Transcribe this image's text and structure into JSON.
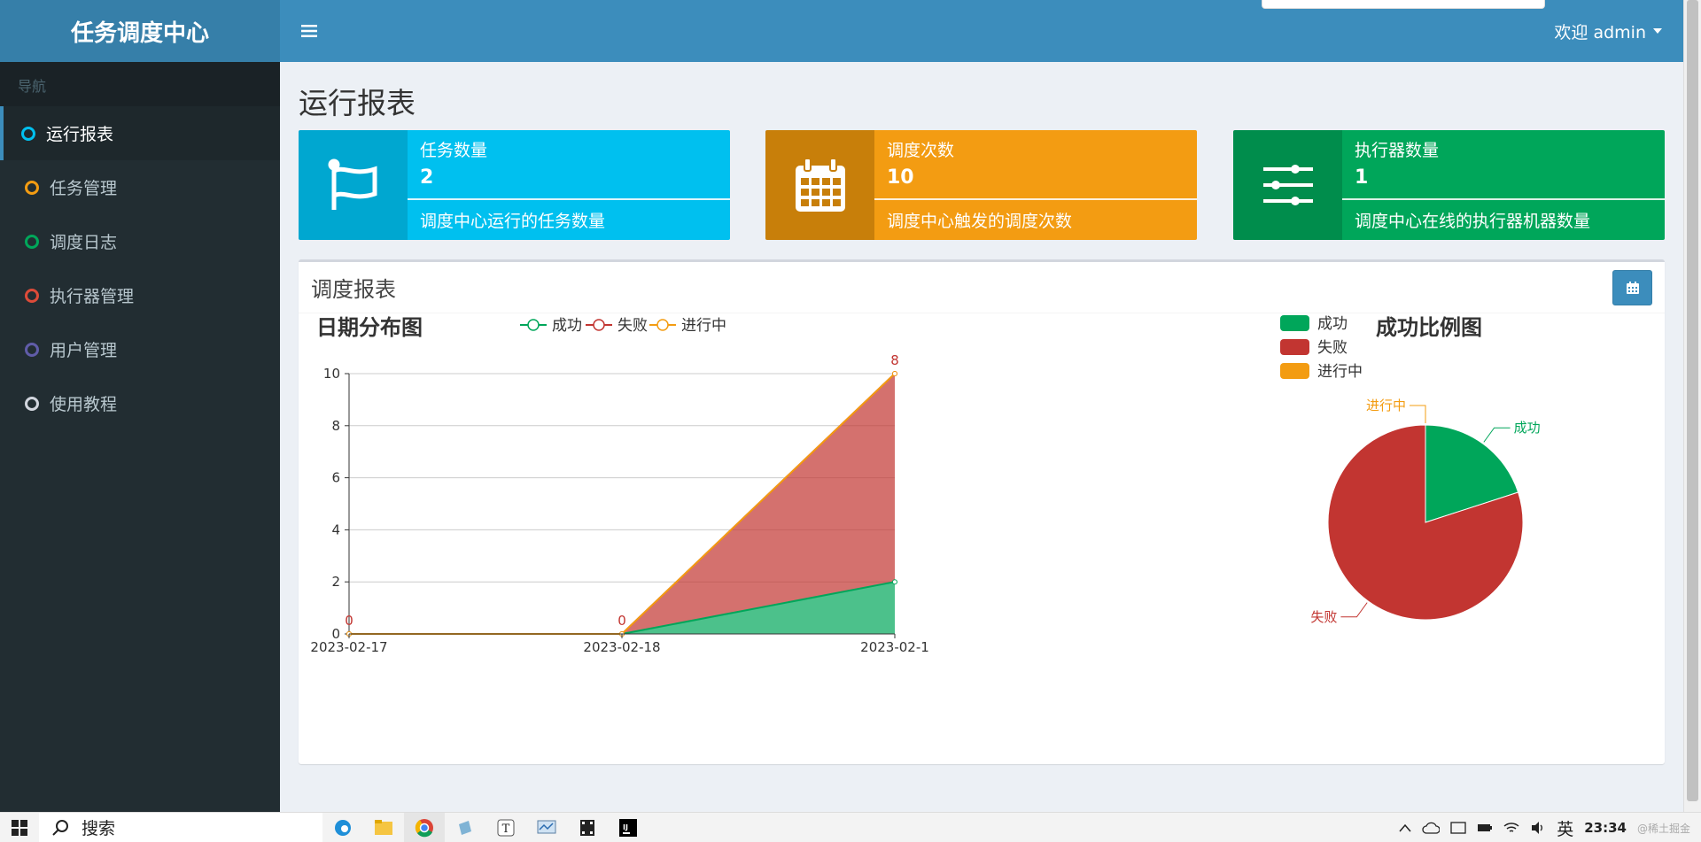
{
  "app": {
    "title": "任务调度中心"
  },
  "header": {
    "welcome": "欢迎 admin"
  },
  "nav": {
    "header": "导航",
    "items": [
      {
        "label": "运行报表",
        "color": "#00c0ef",
        "active": true
      },
      {
        "label": "任务管理",
        "color": "#f39c12"
      },
      {
        "label": "调度日志",
        "color": "#00a65a"
      },
      {
        "label": "执行器管理",
        "color": "#dd4b39"
      },
      {
        "label": "用户管理",
        "color": "#605ca8"
      },
      {
        "label": "使用教程",
        "color": "#d2d6de"
      }
    ]
  },
  "page": {
    "title": "运行报表"
  },
  "info_boxes": [
    {
      "label": "任务数量",
      "value": "2",
      "desc": "调度中心运行的任务数量",
      "icon": "flag-icon",
      "color": "#00c0ef",
      "icon_bg": "#00a7d0"
    },
    {
      "label": "调度次数",
      "value": "10",
      "desc": "调度中心触发的调度次数",
      "icon": "calendar-icon",
      "color": "#f39c12",
      "icon_bg": "#c87f0a"
    },
    {
      "label": "执行器数量",
      "value": "1",
      "desc": "调度中心在线的执行器机器数量",
      "icon": "sliders-icon",
      "color": "#00a65a",
      "icon_bg": "#008d4c"
    }
  ],
  "panel": {
    "title": "调度报表"
  },
  "chart_data": [
    {
      "type": "area",
      "title": "日期分布图",
      "legend": [
        "成功",
        "失败",
        "进行中"
      ],
      "legend_position": "top",
      "categories": [
        "2023-02-17",
        "2023-02-18",
        "2023-02-1"
      ],
      "stacked": true,
      "series": [
        {
          "name": "成功",
          "values": [
            0,
            0,
            2
          ],
          "color": "#00a65a"
        },
        {
          "name": "失败",
          "values": [
            0,
            0,
            8
          ],
          "color": "#c23531"
        },
        {
          "name": "进行中",
          "values": [
            0,
            0,
            0
          ],
          "color": "#f39c12"
        }
      ],
      "data_labels": [
        "0",
        "0",
        "8"
      ],
      "ylim": [
        0,
        10
      ],
      "yticks": [
        0,
        2,
        4,
        6,
        8,
        10
      ],
      "grid": true
    },
    {
      "type": "pie",
      "title": "成功比例图",
      "legend": [
        "成功",
        "失败",
        "进行中"
      ],
      "legend_position": "top-left",
      "slices": [
        {
          "name": "成功",
          "value": 2,
          "color": "#00a65a"
        },
        {
          "name": "失败",
          "value": 8,
          "color": "#c23531"
        },
        {
          "name": "进行中",
          "value": 0,
          "color": "#f39c12"
        }
      ]
    }
  ],
  "taskbar": {
    "search": "搜索",
    "ime": "英",
    "time": "23:34",
    "watermark": "@稀土掘金"
  }
}
